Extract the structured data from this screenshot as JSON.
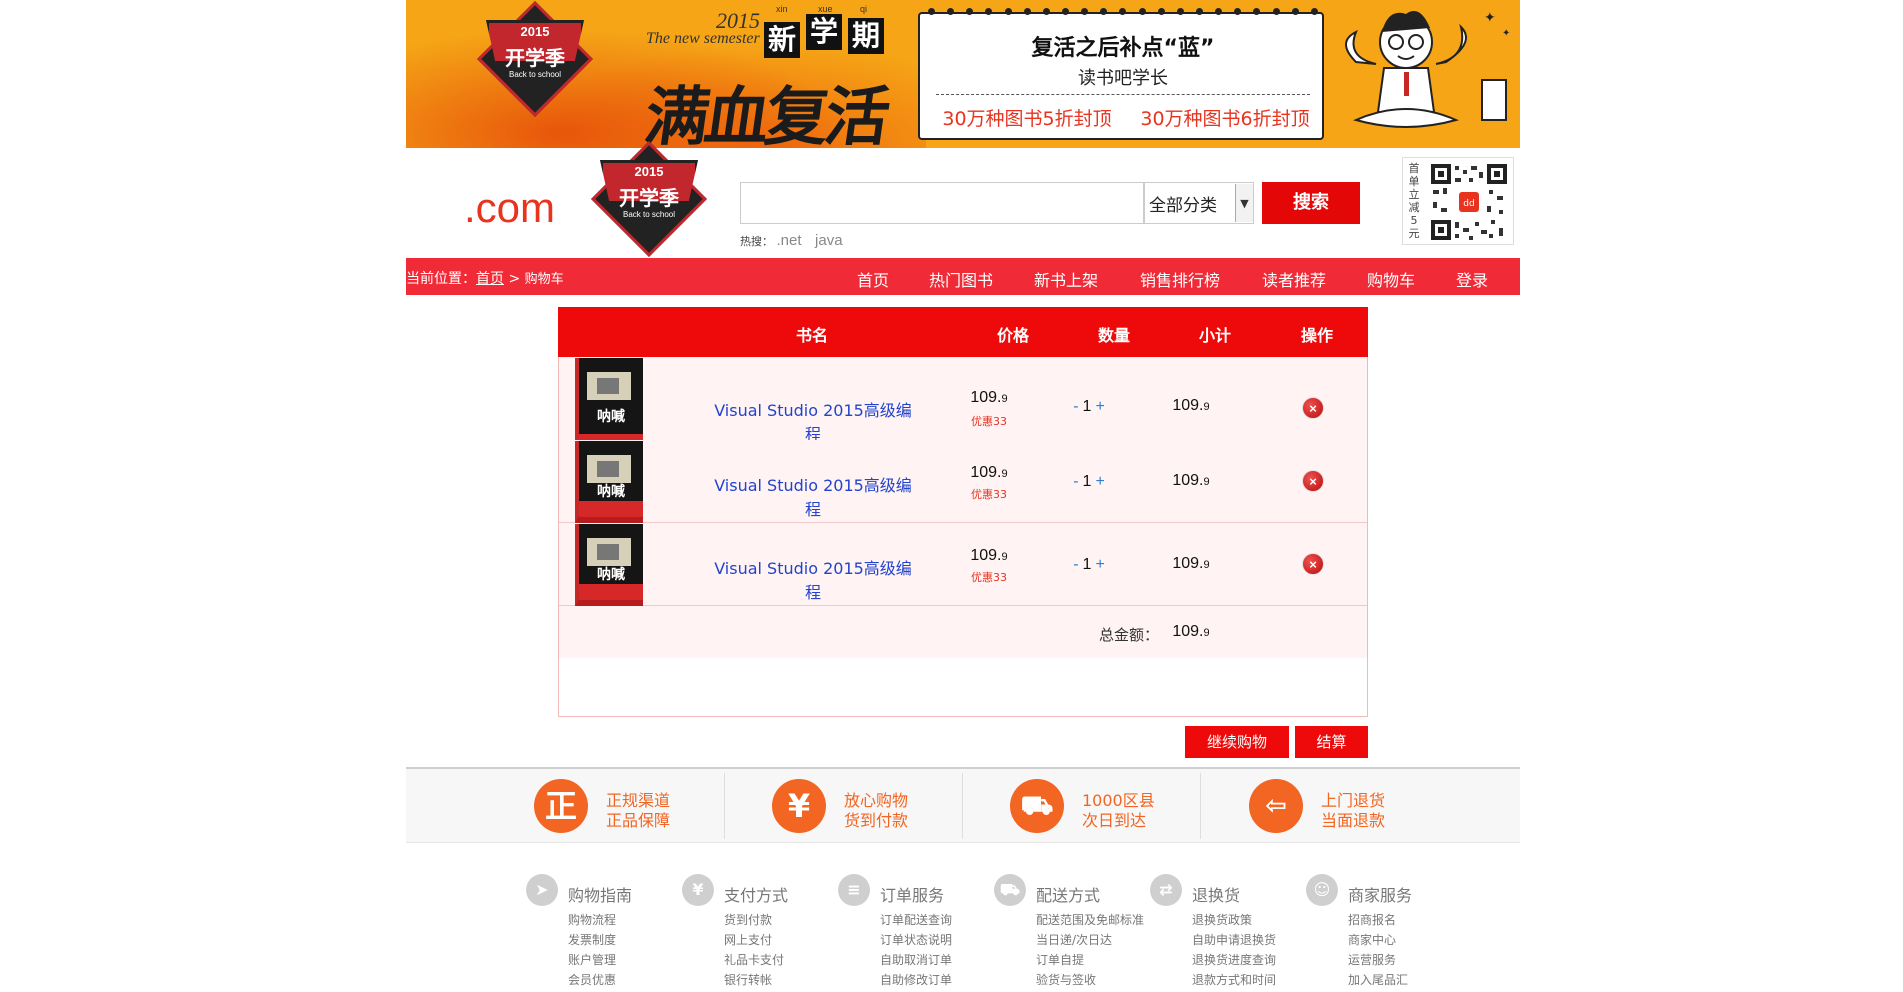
{
  "banner": {
    "badge_year": "2015",
    "badge_name": "开学季",
    "badge_sub": "Back to school",
    "year": "2015",
    "en": "The new semester",
    "sem_chars": [
      "新",
      "学",
      "期"
    ],
    "sem_pinyin": [
      "xin",
      "xue",
      "qi"
    ],
    "headline": "满血复活",
    "paper_title": "复活之后补点“蓝”",
    "paper_author": "读书吧学长",
    "promo_1": "30万种图书5折封顶",
    "promo_2": "30万种图书6折封顶"
  },
  "header": {
    "logo_com": ".com",
    "logo_badge_year": "2015",
    "logo_badge_name": "开学季",
    "logo_badge_sub": "Back to school",
    "search_value": "",
    "category_selected": "全部分类",
    "search_button": "搜索",
    "hot_label": "热搜：",
    "hot_keywords": [
      ".net",
      "java"
    ],
    "qr_caption": [
      "首",
      "单",
      "立",
      "减",
      "5",
      "元"
    ]
  },
  "navbar": {
    "crumb_label": "当前位置：",
    "crumb_home": "首页",
    "crumb_sep": ">",
    "crumb_current": "购物车",
    "items": [
      "首页",
      "热门图书",
      "新书上架",
      "销售排行榜",
      "读者推荐",
      "购物车",
      "登录"
    ]
  },
  "cart": {
    "headers": [
      "书名",
      "价格",
      "数量",
      "小计",
      "操作"
    ],
    "items": [
      {
        "cover_title": "呐喊",
        "name": "Visual Studio 2015高级编程",
        "price_int": "109.",
        "price_dec": "9",
        "discount": "优惠33",
        "qty_minus": "-",
        "qty": "1",
        "qty_plus": "+",
        "subtotal_int": "109.",
        "subtotal_dec": "9",
        "delete_icon": "×"
      },
      {
        "cover_title": "呐喊",
        "name": "Visual Studio 2015高级编程",
        "price_int": "109.",
        "price_dec": "9",
        "discount": "优惠33",
        "qty_minus": "-",
        "qty": "1",
        "qty_plus": "+",
        "subtotal_int": "109.",
        "subtotal_dec": "9",
        "delete_icon": "×"
      },
      {
        "cover_title": "呐喊",
        "name": "Visual Studio 2015高级编程",
        "price_int": "109.",
        "price_dec": "9",
        "discount": "优惠33",
        "qty_minus": "-",
        "qty": "1",
        "qty_plus": "+",
        "subtotal_int": "109.",
        "subtotal_dec": "9",
        "delete_icon": "×"
      }
    ],
    "total_label": "总金额：",
    "total_int": "109.",
    "total_dec": "9",
    "continue_button": "继续购物",
    "checkout_button": "结算"
  },
  "guarantees": [
    {
      "icon": "正",
      "line1": "正规渠道",
      "line2": "正品保障"
    },
    {
      "icon": "¥",
      "line1": "放心购物",
      "line2": "货到付款"
    },
    {
      "icon": "⛟",
      "line1": "1000区县",
      "line2": "次日到达"
    },
    {
      "icon": "⇦",
      "line1": "上门退货",
      "line2": "当面退款"
    }
  ],
  "footer": [
    {
      "icon": "➤",
      "title": "购物指南",
      "links": [
        "购物流程",
        "发票制度",
        "账户管理",
        "会员优惠"
      ]
    },
    {
      "icon": "¥",
      "title": "支付方式",
      "links": [
        "货到付款",
        "网上支付",
        "礼品卡支付",
        "银行转帐"
      ]
    },
    {
      "icon": "≡",
      "title": "订单服务",
      "links": [
        "订单配送查询",
        "订单状态说明",
        "自助取消订单",
        "自助修改订单"
      ]
    },
    {
      "icon": "⛟",
      "title": "配送方式",
      "links": [
        "配送范围及免邮标准",
        "当日递/次日达",
        "订单自提",
        "验货与签收"
      ]
    },
    {
      "icon": "⇄",
      "title": "退换货",
      "links": [
        "退换货政策",
        "自助申请退换货",
        "退换货进度查询",
        "退款方式和时间"
      ]
    },
    {
      "icon": "☺",
      "title": "商家服务",
      "links": [
        "招商报名",
        "商家中心",
        "运营服务",
        "加入尾品汇"
      ]
    }
  ],
  "colors": {
    "accent_red": "#ee0a0a",
    "nav_red": "#f02b37",
    "orange": "#f26522",
    "link_blue": "#2244cc",
    "banner_yellow": "#f5a516"
  }
}
